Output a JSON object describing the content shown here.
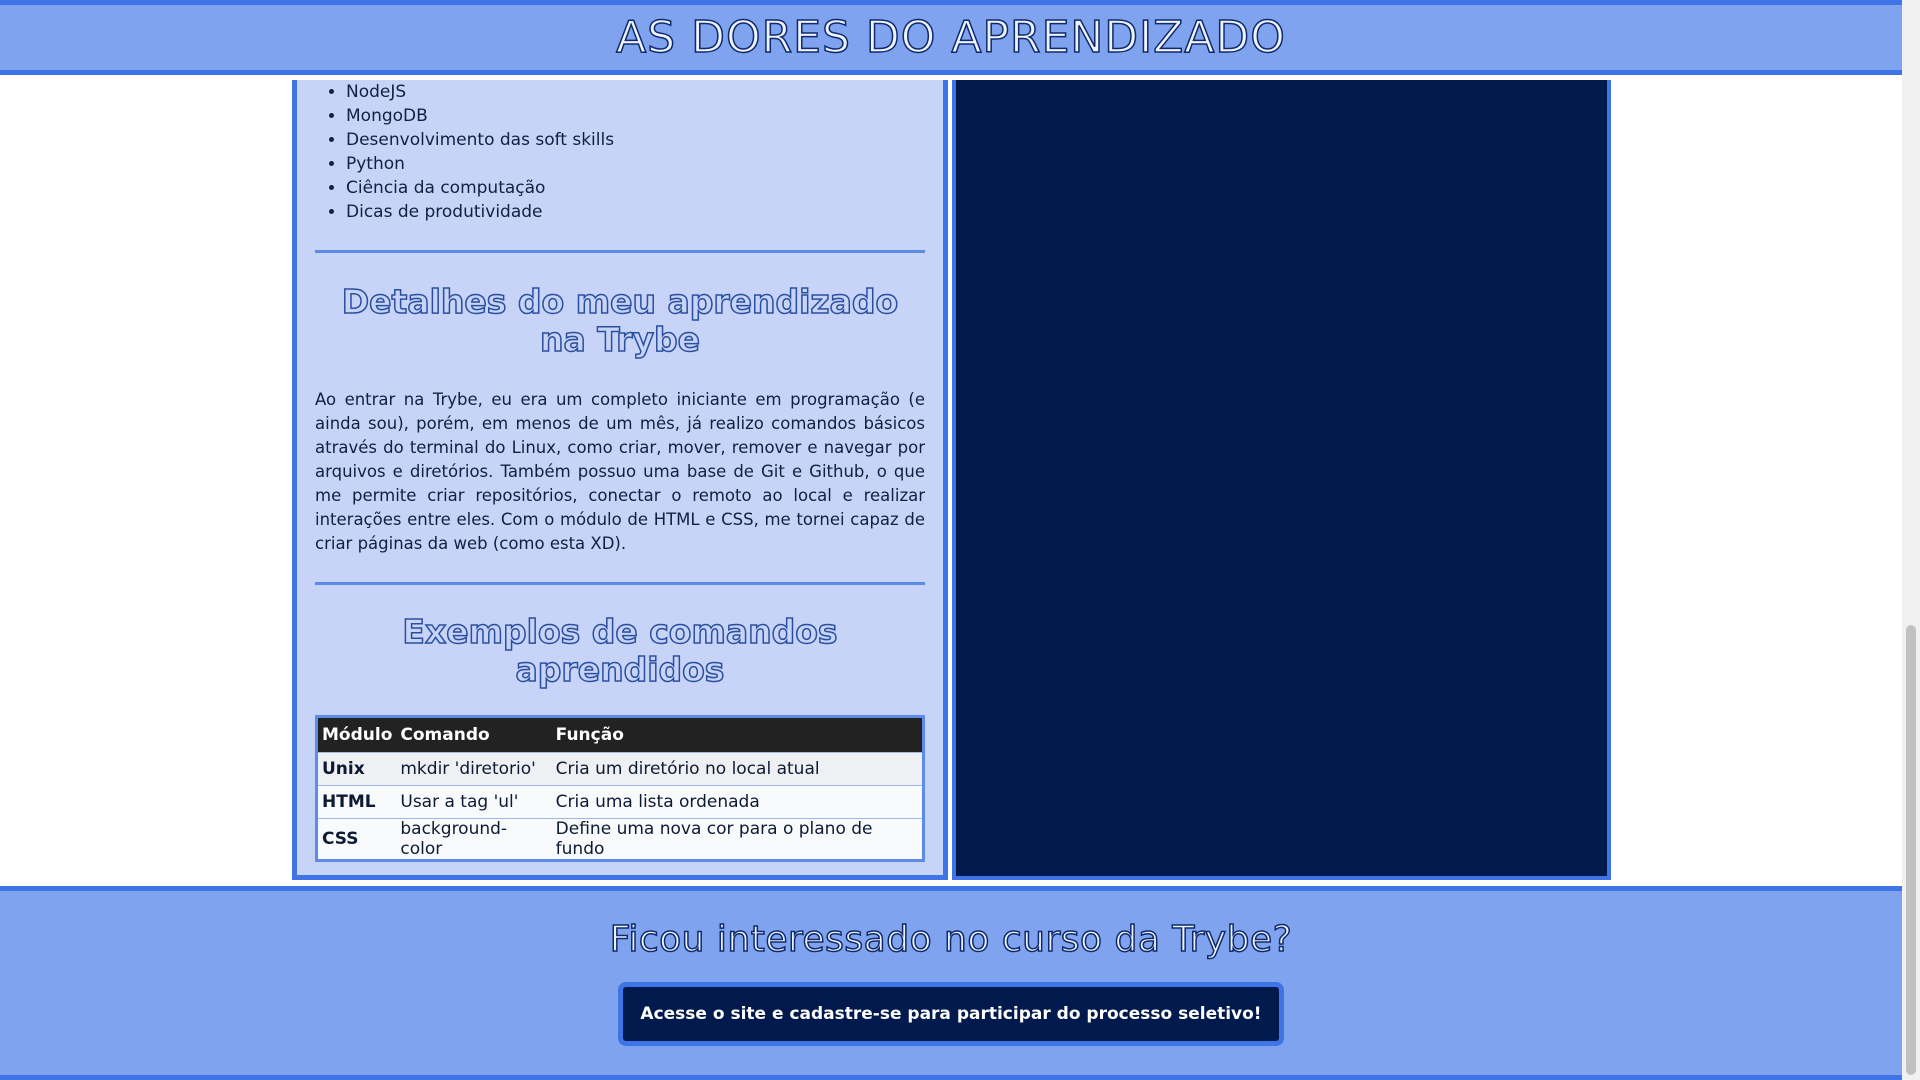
{
  "header": {
    "title": "AS DORES DO APRENDIZADO"
  },
  "topics": [
    "NodeJS",
    "MongoDB",
    "Desenvolvimento das soft skills",
    "Python",
    "Ciência da computação",
    "Dicas de produtividade"
  ],
  "details": {
    "title": "Detalhes do meu aprendizado na Trybe",
    "text": "Ao entrar na Trybe, eu era um completo iniciante em programação (e ainda sou), porém, em menos de um mês, já realizo comandos básicos através do terminal do Linux, como criar, mover, remover e navegar por arquivos e diretórios. Também possuo uma base de Git e Github, o que me permite criar repositórios, conectar o remoto ao local e realizar interações entre eles. Com o módulo de HTML e CSS, me tornei capaz de criar páginas da web (como esta XD)."
  },
  "examples": {
    "title": "Exemplos de comandos aprendidos",
    "columns": [
      "Módulo",
      "Comando",
      "Função"
    ],
    "rows": [
      [
        "Unix",
        "mkdir 'diretorio'",
        "Cria um diretório no local atual"
      ],
      [
        "HTML",
        "Usar a tag 'ul'",
        "Cria uma lista ordenada"
      ],
      [
        "CSS",
        "background-color",
        "Define uma nova cor para o plano de fundo"
      ]
    ]
  },
  "footer": {
    "title": "Ficou interessado no curso da Trybe?",
    "cta_label": "Acesse o site e cadastre-se para participar do processo seletivo!"
  },
  "colors": {
    "header_bg": "#7fa3ef",
    "accent_border": "#3f74e6",
    "left_panel_bg": "#c7d4f7",
    "right_panel_bg": "#001a4e"
  }
}
